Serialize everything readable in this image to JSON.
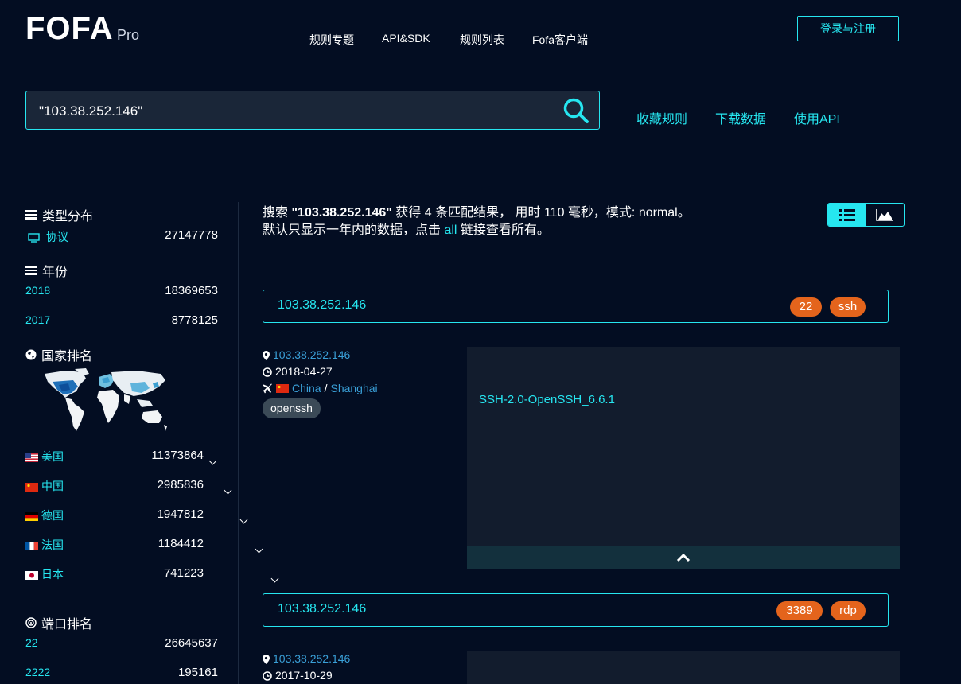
{
  "header": {
    "logo_text": "FOFA",
    "logo_sub": "Pro",
    "nav": [
      "规则专题",
      "API&SDK",
      "规则列表",
      "Fofa客户端"
    ],
    "login_label": "登录与注册"
  },
  "search": {
    "query": "\"103.38.252.146\"",
    "actions": [
      "收藏规则",
      "下载数据",
      "使用API"
    ]
  },
  "sidebar": {
    "type_title": "类型分布",
    "type_items": [
      {
        "label": "协议",
        "count": "27147778"
      }
    ],
    "year_title": "年份",
    "years": [
      {
        "label": "2018",
        "count": "18369653"
      },
      {
        "label": "2017",
        "count": "8778125"
      }
    ],
    "country_title": "国家排名",
    "countries": [
      {
        "label": "美国",
        "count": "11373864"
      },
      {
        "label": "中国",
        "count": "2985836"
      },
      {
        "label": "德国",
        "count": "1947812"
      },
      {
        "label": "法国",
        "count": "1184412"
      },
      {
        "label": "日本",
        "count": "741223"
      }
    ],
    "port_title": "端口排名",
    "ports": [
      {
        "label": "22",
        "count": "26645637"
      },
      {
        "label": "2222",
        "count": "195161"
      }
    ]
  },
  "summary": {
    "prefix": "搜索 ",
    "query": "\"103.38.252.146\"",
    "mid": " 获得 4 条匹配结果， 用时 110 毫秒，模式: normal。",
    "line2_prefix": "默认只显示一年内的数据，点击 ",
    "all_link": "all",
    "line2_suffix": " 链接查看所有。"
  },
  "results": [
    {
      "host": "103.38.252.146",
      "port": "22",
      "protocol": "ssh",
      "ip": "103.38.252.146",
      "date": "2018-04-27",
      "country": "China",
      "city": "Shanghai",
      "tag": "openssh",
      "banner": "SSH-2.0-OpenSSH_6.6.1"
    },
    {
      "host": "103.38.252.146",
      "port": "3389",
      "protocol": "rdp",
      "ip": "103.38.252.146",
      "date": "2017-10-29"
    }
  ],
  "colors": {
    "accent": "#26e6f0",
    "background": "#030d22",
    "port_badge": "#e4641c",
    "link": "#3aa0d8"
  }
}
